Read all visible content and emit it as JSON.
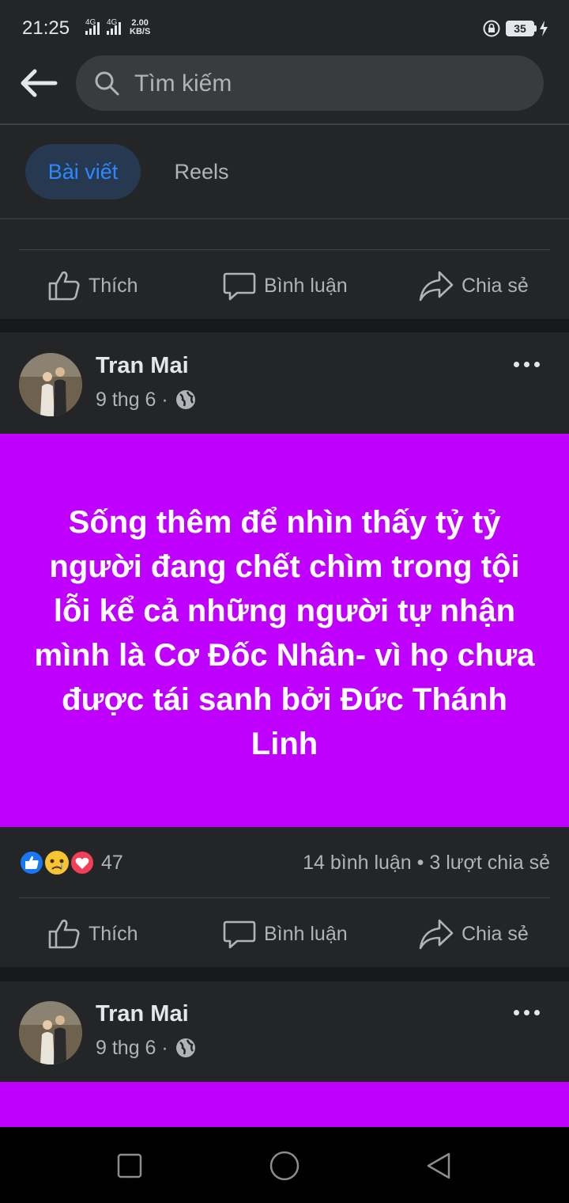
{
  "status_bar": {
    "time": "21:25",
    "net_1": "4G",
    "net_2": "4G",
    "speed_value": "2.00",
    "speed_unit": "KB/S",
    "battery": "35"
  },
  "search": {
    "placeholder": "Tìm kiếm"
  },
  "tabs": [
    {
      "label": "Bài viết",
      "active": true
    },
    {
      "label": "Reels",
      "active": false
    }
  ],
  "actions": {
    "like": "Thích",
    "comment": "Bình luận",
    "share": "Chia sẻ"
  },
  "posts": [
    {
      "author": "Tran Mai",
      "date": "9 thg 6 ·",
      "text": "Sống thêm để nhìn thấy tỷ tỷ người đang chết chìm trong tội lỗi kể cả những người tự nhận mình là Cơ Đốc Nhân- vì họ chưa được tái sanh bởi Đức Thánh Linh",
      "background_color": "#c000ff",
      "reaction_count": "47",
      "reactions": [
        "like-icon",
        "sad-icon",
        "love-icon"
      ],
      "engagement": "14 bình luận • 3 lượt chia sẻ"
    },
    {
      "author": "Tran Mai",
      "date": "9 thg 6 ·",
      "background_color": "#c000ff"
    }
  ],
  "colors": {
    "background": "#18191a",
    "card": "#242526",
    "accent": "#2d88ff",
    "post_bg": "#c000ff"
  }
}
